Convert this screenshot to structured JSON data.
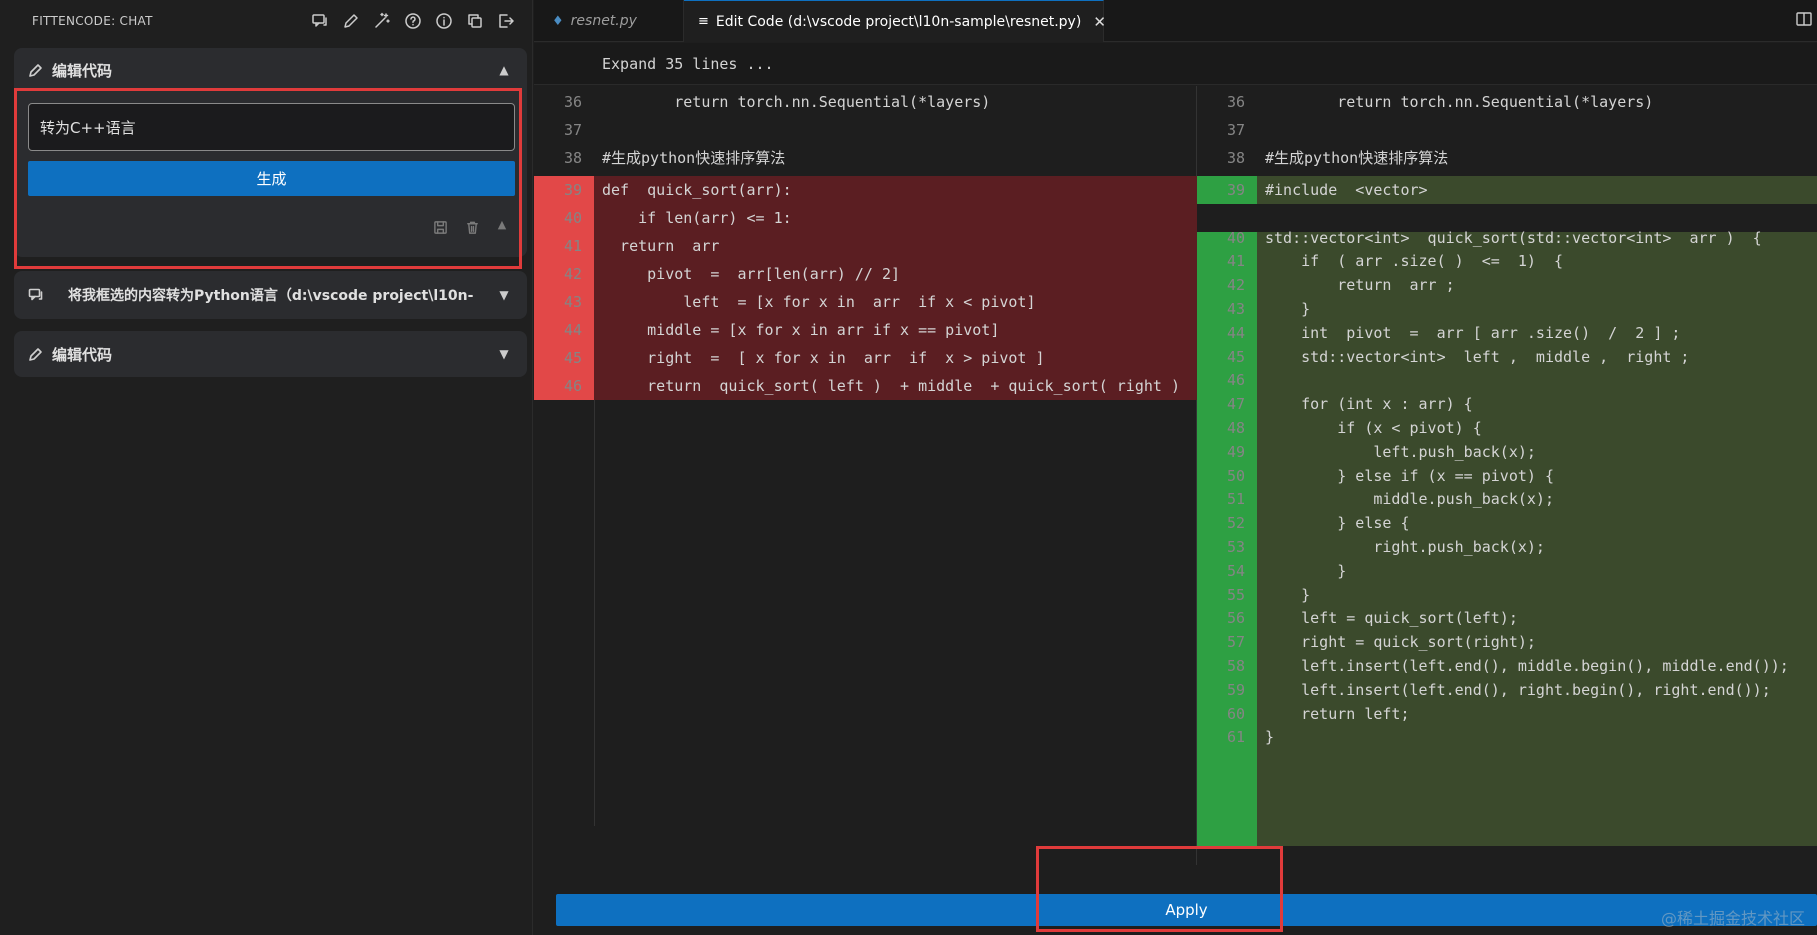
{
  "sidebar": {
    "title": "FITTENCODE: CHAT",
    "header_icons": [
      "chat-icon",
      "pencil-icon",
      "magic-wand-icon",
      "help-icon",
      "info-icon",
      "copy-icon",
      "exit-icon"
    ],
    "card1": {
      "title": "编辑代码",
      "input_value": "转为C++语言",
      "generate_label": "生成"
    },
    "card2": {
      "title": "将我框选的内容转为Python语言（d:\\vscode project\\l10n-"
    },
    "card3": {
      "title": "编辑代码"
    }
  },
  "tabs": [
    {
      "label": "resnet.py",
      "icon": "python-file-icon"
    },
    {
      "label": "Edit Code (d:\\vscode project\\l10n-sample\\resnet.py)",
      "icon": "diff-icon",
      "close": "✕"
    }
  ],
  "editor": {
    "expand_label": "Expand 35 lines ...",
    "context": [
      {
        "ln": "36",
        "text": "        return torch.nn.Sequential(*layers)"
      },
      {
        "ln": "37",
        "text": ""
      },
      {
        "ln": "38",
        "text": "#生成python快速排序算法"
      }
    ],
    "left": [
      {
        "ln": "39",
        "text": "def  quick_sort(arr):"
      },
      {
        "ln": "40",
        "text": "    if len(arr) <= 1:"
      },
      {
        "ln": "41",
        "text": "  return  arr"
      },
      {
        "ln": "42",
        "text": "     pivot  =  arr[len(arr) // 2]"
      },
      {
        "ln": "43",
        "text": "         left  = [x for x in  arr  if x < pivot]"
      },
      {
        "ln": "44",
        "text": "     middle = [x for x in arr if x == pivot]"
      },
      {
        "ln": "45",
        "text": "     right  =  [ x for x in  arr  if  x > pivot ]"
      },
      {
        "ln": "46",
        "text": "     return  quick_sort( left )  + middle  + quick_sort( right )"
      }
    ],
    "right": [
      {
        "ln": "39",
        "text": "#include  <vector>"
      },
      {
        "ln": "",
        "text": ""
      },
      {
        "ln": "40",
        "text": "std::vector<int>  quick_sort(std::vector<int>  arr )  {"
      },
      {
        "ln": "41",
        "text": "    if  ( arr .size( )  <=  1)  {"
      },
      {
        "ln": "42",
        "text": "        return  arr ;"
      },
      {
        "ln": "43",
        "text": "    }"
      },
      {
        "ln": "44",
        "text": "    int  pivot  =  arr [ arr .size()  /  2 ] ;"
      },
      {
        "ln": "45",
        "text": "    std::vector<int>  left ,  middle ,  right ;"
      },
      {
        "ln": "46",
        "text": ""
      },
      {
        "ln": "47",
        "text": "    for (int x : arr) {"
      },
      {
        "ln": "48",
        "text": "        if (x < pivot) {"
      },
      {
        "ln": "49",
        "text": "            left.push_back(x);"
      },
      {
        "ln": "50",
        "text": "        } else if (x == pivot) {"
      },
      {
        "ln": "51",
        "text": "            middle.push_back(x);"
      },
      {
        "ln": "52",
        "text": "        } else {"
      },
      {
        "ln": "53",
        "text": "            right.push_back(x);"
      },
      {
        "ln": "54",
        "text": "        }"
      },
      {
        "ln": "55",
        "text": "    }"
      },
      {
        "ln": "56",
        "text": "    left = quick_sort(left);"
      },
      {
        "ln": "57",
        "text": "    right = quick_sort(right);"
      },
      {
        "ln": "58",
        "text": "    left.insert(left.end(), middle.begin(), middle.end());"
      },
      {
        "ln": "59",
        "text": "    left.insert(left.end(), right.begin(), right.end());"
      },
      {
        "ln": "60",
        "text": "    return left;"
      },
      {
        "ln": "61",
        "text": "}"
      }
    ]
  },
  "apply_label": "Apply",
  "watermark": "@稀土掘金技术社区",
  "colors": {
    "accent": "#0e70c0",
    "deleted_band": "#5b1e22",
    "deleted_gutter": "#f14c4c",
    "added_band": "#3b4a2c",
    "added_gutter": "#2ea043",
    "highlight_box": "#e03b3b"
  }
}
